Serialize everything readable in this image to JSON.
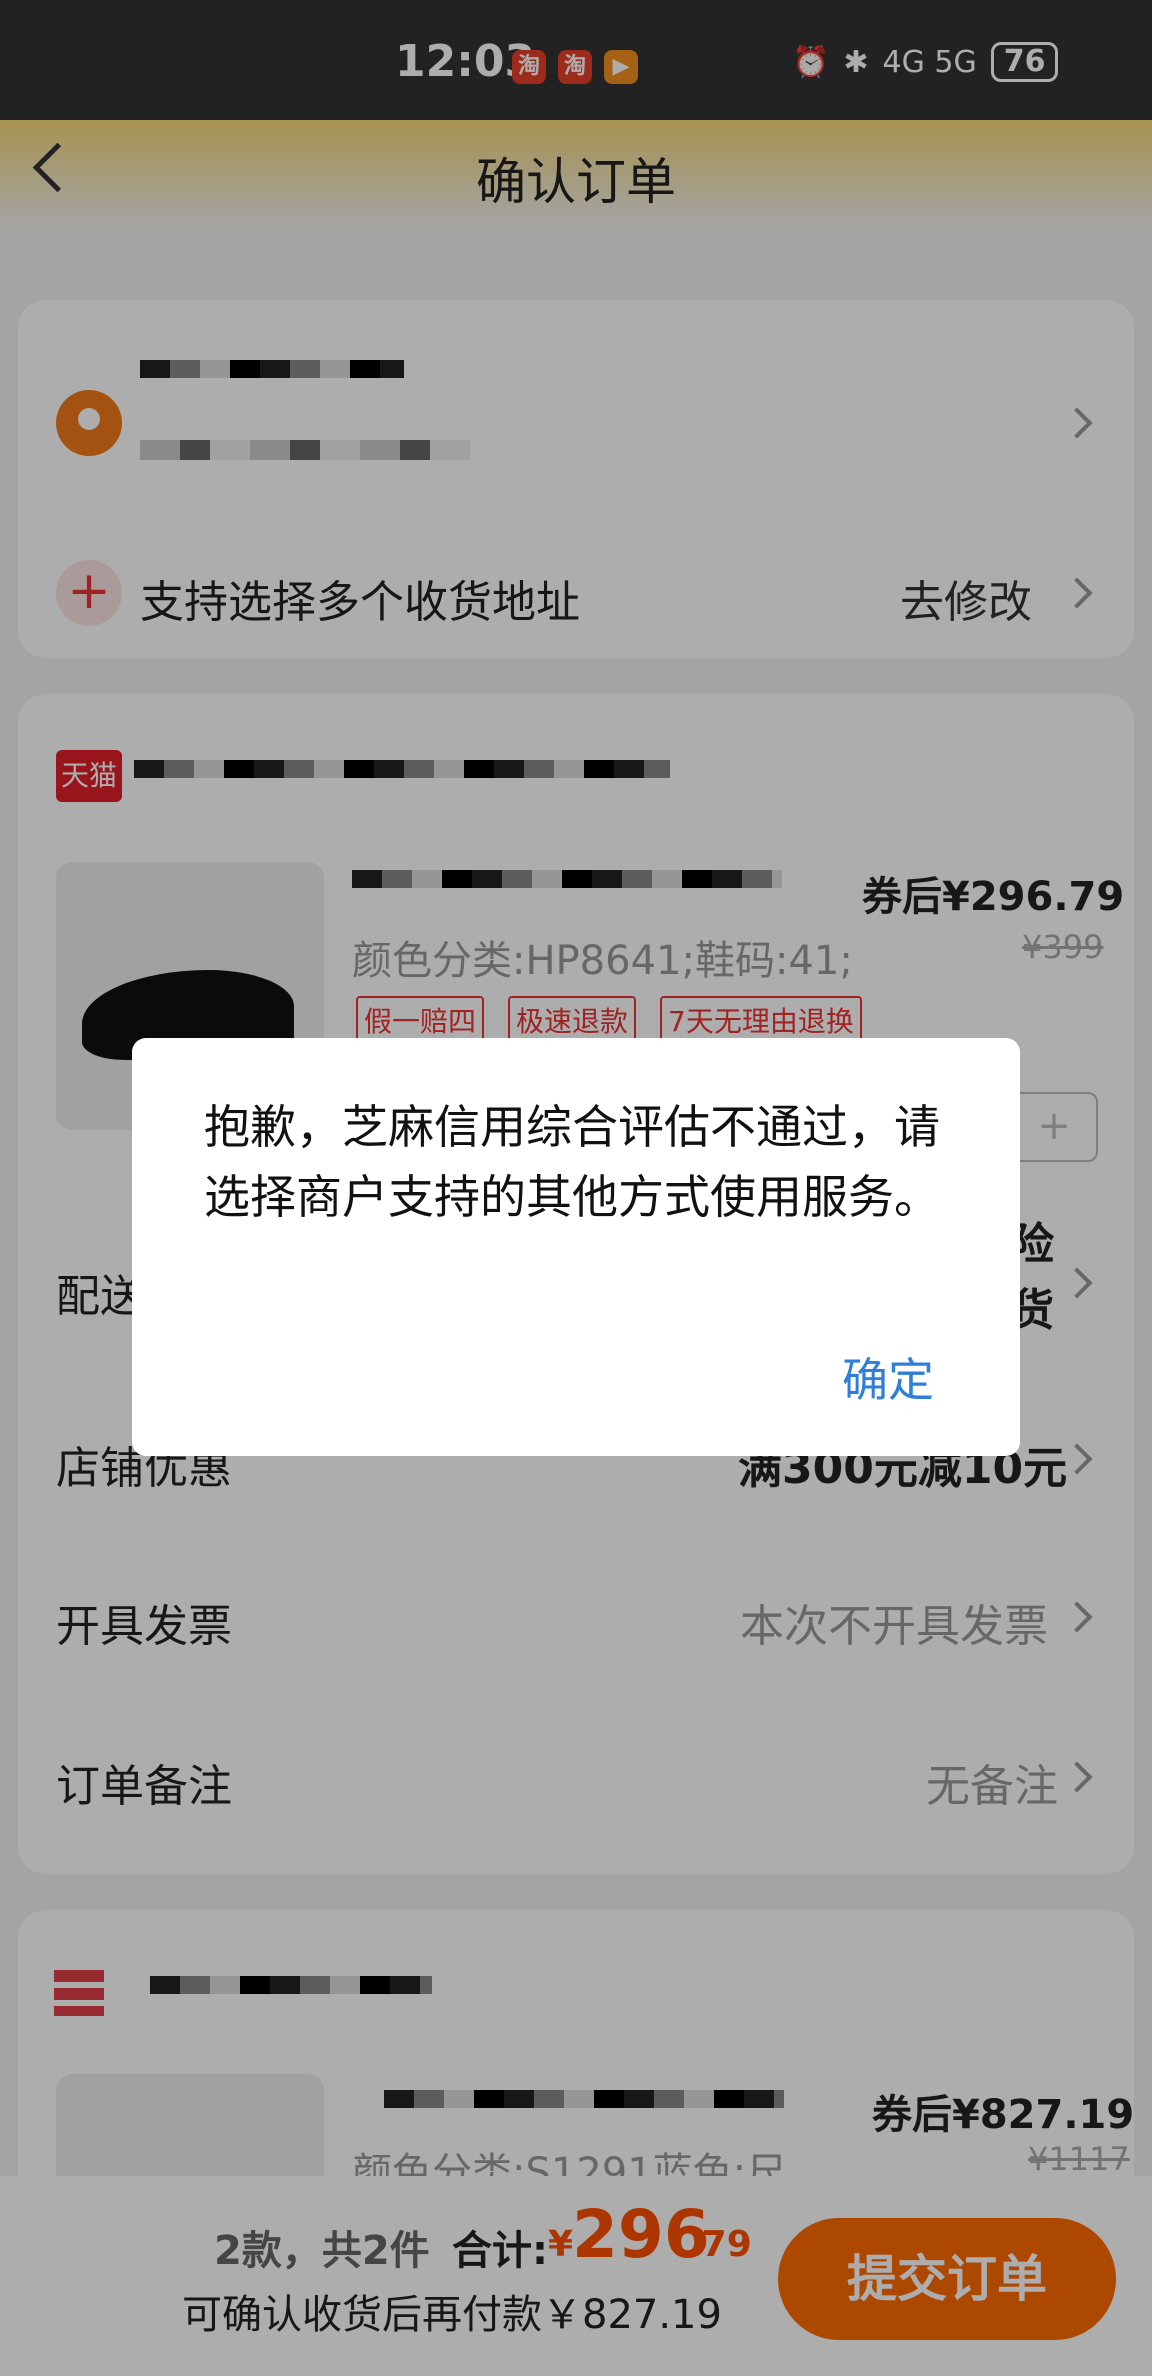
{
  "status_bar": {
    "time": "12:03",
    "app_icons": [
      "淘",
      "淘",
      "▶"
    ],
    "signal": "4G 5G",
    "battery": "76"
  },
  "header": {
    "title": "确认订单"
  },
  "address": {
    "multi_address_label": "支持选择多个收货地址",
    "modify_label": "去修改"
  },
  "shop1": {
    "badge": "天猫",
    "product": {
      "spec": "颜色分类:HP8641;鞋码:41;",
      "price": "券后¥296.79",
      "original_price": "¥399",
      "tags": [
        "假一赔四",
        "极速退款",
        "7天无理由退换"
      ]
    },
    "rows": [
      {
        "label": "配送",
        "value": "险\n货"
      },
      {
        "label": "店铺优惠",
        "value": "满300元减10元"
      },
      {
        "label": "开具发票",
        "value": "本次不开具发票"
      },
      {
        "label": "订单备注",
        "value": "无备注"
      }
    ]
  },
  "shop2": {
    "product": {
      "spec": "颜色分类:S1291蓝色;尺",
      "price": "券后¥827.19",
      "original_price": "¥1117"
    }
  },
  "bottom_bar": {
    "count": "2款，共2件",
    "total_label": "合计:",
    "currency": "¥",
    "total_int": "296",
    "total_dec": ".79",
    "later_pay": "可确认收货后再付款￥827.19",
    "submit": "提交订单"
  },
  "dialog": {
    "message": "抱歉，芝麻信用综合评估不通过，请选择商户支持的其他方式使用服务。",
    "confirm": "确定"
  }
}
